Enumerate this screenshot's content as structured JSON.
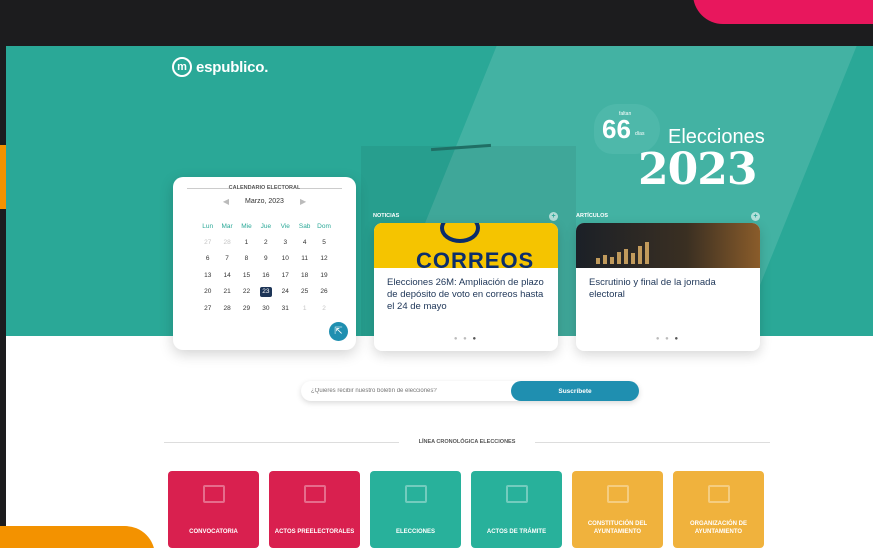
{
  "brand": {
    "logo_text": "espublico."
  },
  "countdown": {
    "prefix": "faltan",
    "number": "66",
    "suffix": "días"
  },
  "hero": {
    "title": "Elecciones",
    "year": "2023"
  },
  "calendar": {
    "title": "CALENDARIO ELECTORAL",
    "month": "Marzo, 2023",
    "weekdays": [
      "Lun",
      "Mar",
      "Mie",
      "Jue",
      "Vie",
      "Sab",
      "Dom"
    ],
    "days": [
      [
        "27",
        "28",
        "1",
        "2",
        "3",
        "4",
        "5"
      ],
      [
        "6",
        "7",
        "8",
        "9",
        "10",
        "11",
        "12"
      ],
      [
        "13",
        "14",
        "15",
        "16",
        "17",
        "18",
        "19"
      ],
      [
        "20",
        "21",
        "22",
        "23",
        "24",
        "25",
        "26"
      ],
      [
        "27",
        "28",
        "29",
        "30",
        "31",
        "1",
        "2"
      ]
    ],
    "selected_day": "23"
  },
  "sections": {
    "news_label": "NOTICIAS",
    "articles_label": "ARTÍCULOS"
  },
  "news_card": {
    "image_text": "CORREOS",
    "headline": "Elecciones 26M: Ampliación de plazo de depósito de voto en correos hasta el 24 de mayo"
  },
  "article_card": {
    "headline": "Escrutinio y final de la jornada electoral"
  },
  "newsletter": {
    "placeholder": "¿Quieres recibir nuestro boletín de elecciones?",
    "button_label": "Suscríbete"
  },
  "timeline": {
    "title": "LÍNEA CRONOLÓGICA ELECCIONES",
    "items": [
      {
        "label": "CONVOCATORIA",
        "color": "#d9204f",
        "icon": "building-icon"
      },
      {
        "label": "ACTOS PREELECTORALES",
        "color": "#d9204f",
        "icon": "megaphone-icon"
      },
      {
        "label": "ELECCIONES",
        "color": "#28b19b",
        "icon": "ballot-box-icon"
      },
      {
        "label": "ACTOS DE TRÁMITE",
        "color": "#28b19b",
        "icon": "document-icon"
      },
      {
        "label": "CONSTITUCIÓN DEL AYUNTAMIENTO",
        "color": "#f0b23d",
        "icon": "town-hall-icon"
      },
      {
        "label": "ORGANIZACIÓN DE AYUNTAMIENTO",
        "color": "#f0b23d",
        "icon": "organization-icon"
      }
    ]
  },
  "colors": {
    "teal": "#2aa897",
    "blue": "#1f8fb0",
    "navy": "#1d3557",
    "pink": "#e8175d",
    "orange": "#f39200"
  }
}
